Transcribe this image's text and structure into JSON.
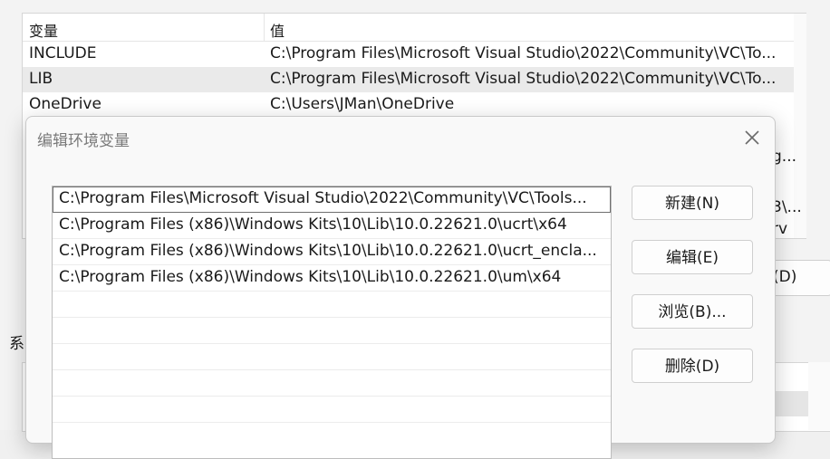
{
  "background_window": {
    "columns": {
      "variable": "变量",
      "value": "值"
    },
    "user_vars": [
      {
        "name": "INCLUDE",
        "value": "C:\\Program Files\\Microsoft Visual Studio\\2022\\Community\\VC\\To..."
      },
      {
        "name": "LIB",
        "value": "C:\\Program Files\\Microsoft Visual Studio\\2022\\Community\\VC\\To..."
      },
      {
        "name": "OneDrive",
        "value": "C:\\Users\\JMan\\OneDrive"
      }
    ],
    "peek_texts": [
      "g...",
      "3\\...",
      "rv"
    ],
    "partial_button_label": "(D)",
    "system_section_label": "系"
  },
  "dialog": {
    "title": "编辑环境变量",
    "paths": [
      "C:\\Program Files\\Microsoft Visual Studio\\2022\\Community\\VC\\Tools...",
      "C:\\Program Files (x86)\\Windows Kits\\10\\Lib\\10.0.22621.0\\ucrt\\x64",
      "C:\\Program Files (x86)\\Windows Kits\\10\\Lib\\10.0.22621.0\\ucrt_encla...",
      "C:\\Program Files (x86)\\Windows Kits\\10\\Lib\\10.0.22621.0\\um\\x64"
    ],
    "buttons": {
      "new": "新建(N)",
      "edit": "编辑(E)",
      "browse": "浏览(B)...",
      "delete": "删除(D)"
    }
  }
}
